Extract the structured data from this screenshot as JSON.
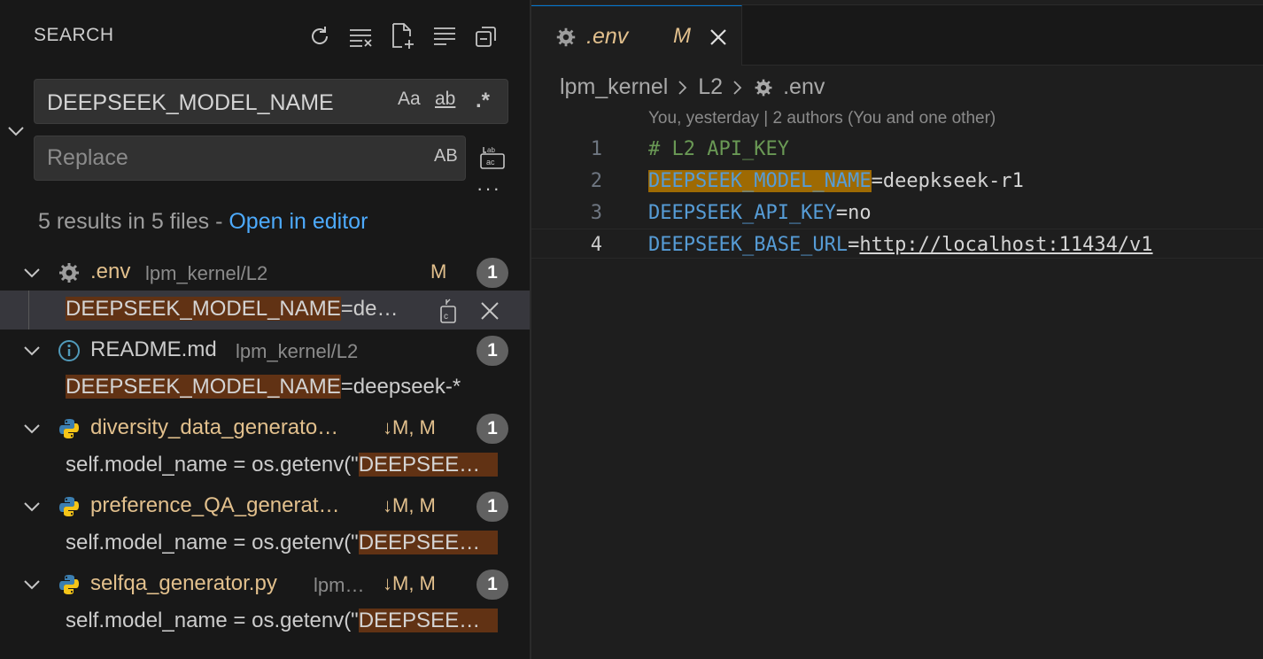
{
  "search": {
    "title": "SEARCH",
    "query": "DEEPSEEK_MODEL_NAME",
    "match_case_label": "Aa",
    "whole_word_label": "ab",
    "regex_label": ".*",
    "replace_placeholder": "Replace",
    "preserve_case_label": "AB",
    "more_label": "···",
    "summary_text": "5 results in 5 files - ",
    "open_in_editor": "Open in editor"
  },
  "actions": [
    "refresh-icon",
    "clear-results-icon",
    "new-search-editor-icon",
    "view-as-tree-icon",
    "collapse-all-icon"
  ],
  "results": [
    {
      "file": ".env",
      "path": "lpm_kernel/L2",
      "status": "M",
      "count": "1",
      "icon": "gear-icon",
      "match_highlight": "DEEPSEEK_MODEL_NAME",
      "match_rest": "=de…"
    },
    {
      "file": "README.md",
      "path": "lpm_kernel/L2",
      "status": "",
      "count": "1",
      "icon": "info-icon",
      "match_highlight": "DEEPSEEK_MODEL_NAME",
      "match_rest": "=deepseek-*"
    },
    {
      "file": "diversity_data_generato…",
      "path": "",
      "status": "↓M, M",
      "count": "1",
      "icon": "python-icon",
      "match_prefix": "self.model_name = os.getenv(\"",
      "match_highlight": "DEEPSEE…"
    },
    {
      "file": "preference_QA_generat…",
      "path": "",
      "status": "↓M, M",
      "count": "1",
      "icon": "python-icon",
      "match_prefix": "self.model_name = os.getenv(\"",
      "match_highlight": "DEEPSEE…"
    },
    {
      "file": "selfqa_generator.py",
      "path": "lpm…",
      "status": "↓M, M",
      "count": "1",
      "icon": "python-icon",
      "match_prefix": "self.model_name = os.getenv(\"",
      "match_highlight": "DEEPSEE…"
    }
  ],
  "editor": {
    "tab": {
      "name": ".env",
      "modified": "M"
    },
    "breadcrumb": [
      "lpm_kernel",
      "L2",
      ".env"
    ],
    "blame": "You, yesterday | 2 authors (You and one other)",
    "lines": [
      {
        "no": "1",
        "comment": "# L2 API_KEY"
      },
      {
        "no": "2",
        "key": "DEEPSEEK_MODEL_NAME",
        "eq": "=",
        "value": "deepkseek-r1"
      },
      {
        "no": "3",
        "key": "DEEPSEEK_API_KEY",
        "eq": "=",
        "value": "no"
      },
      {
        "no": "4",
        "key": "DEEPSEEK_BASE_URL",
        "eq": "=",
        "value": "http://localhost:11434/v1"
      }
    ]
  },
  "colors": {
    "accent": "#0078d4",
    "link": "#4daafc",
    "modified": "#e2c08d",
    "match_bg": "#613214",
    "editor_match_bg": "#9e6a03",
    "keyword": "#569cd6",
    "comment": "#6a9955"
  }
}
